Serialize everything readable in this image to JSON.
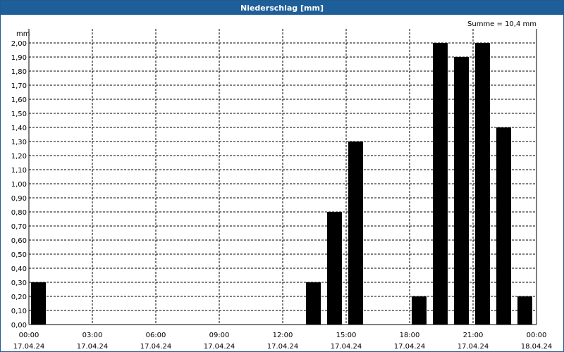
{
  "window": {
    "title": "Niederschlag [mm]"
  },
  "chart_data": {
    "type": "bar",
    "title": "Niederschlag [mm]",
    "ylabel": "mm",
    "sum_label": "Summe = 10,4 mm",
    "ylim": [
      0,
      2.1
    ],
    "xlim_hours": [
      0,
      24
    ],
    "grid": true,
    "x_ticks": [
      {
        "time": "00:00",
        "date": "17.04.24"
      },
      {
        "time": "03:00",
        "date": "17.04.24"
      },
      {
        "time": "06:00",
        "date": "17.04.24"
      },
      {
        "time": "09:00",
        "date": "17.04.24"
      },
      {
        "time": "12:00",
        "date": "17.04.24"
      },
      {
        "time": "15:00",
        "date": "17.04.24"
      },
      {
        "time": "18:00",
        "date": "17.04.24"
      },
      {
        "time": "21:00",
        "date": "17.04.24"
      },
      {
        "time": "00:00",
        "date": "18.04.24"
      }
    ],
    "y_ticks": [
      "0,00",
      "0,10",
      "0,20",
      "0,30",
      "0,40",
      "0,50",
      "0,60",
      "0,70",
      "0,80",
      "0,90",
      "1,00",
      "1,10",
      "1,20",
      "1,30",
      "1,40",
      "1,50",
      "1,60",
      "1,70",
      "1,80",
      "1,90",
      "2,00"
    ],
    "bars": [
      {
        "hour": "00:00",
        "value": 0.3
      },
      {
        "hour": "13:00",
        "value": 0.3
      },
      {
        "hour": "14:00",
        "value": 0.8
      },
      {
        "hour": "15:00",
        "value": 1.3
      },
      {
        "hour": "18:00",
        "value": 0.2
      },
      {
        "hour": "19:00",
        "value": 2.0
      },
      {
        "hour": "20:00",
        "value": 1.9
      },
      {
        "hour": "21:00",
        "value": 2.0
      },
      {
        "hour": "22:00",
        "value": 1.4
      },
      {
        "hour": "23:00",
        "value": 0.2
      }
    ],
    "colors": {
      "bar": "#000000",
      "grid": "#000000",
      "title_bg": "#1f5f99"
    }
  }
}
